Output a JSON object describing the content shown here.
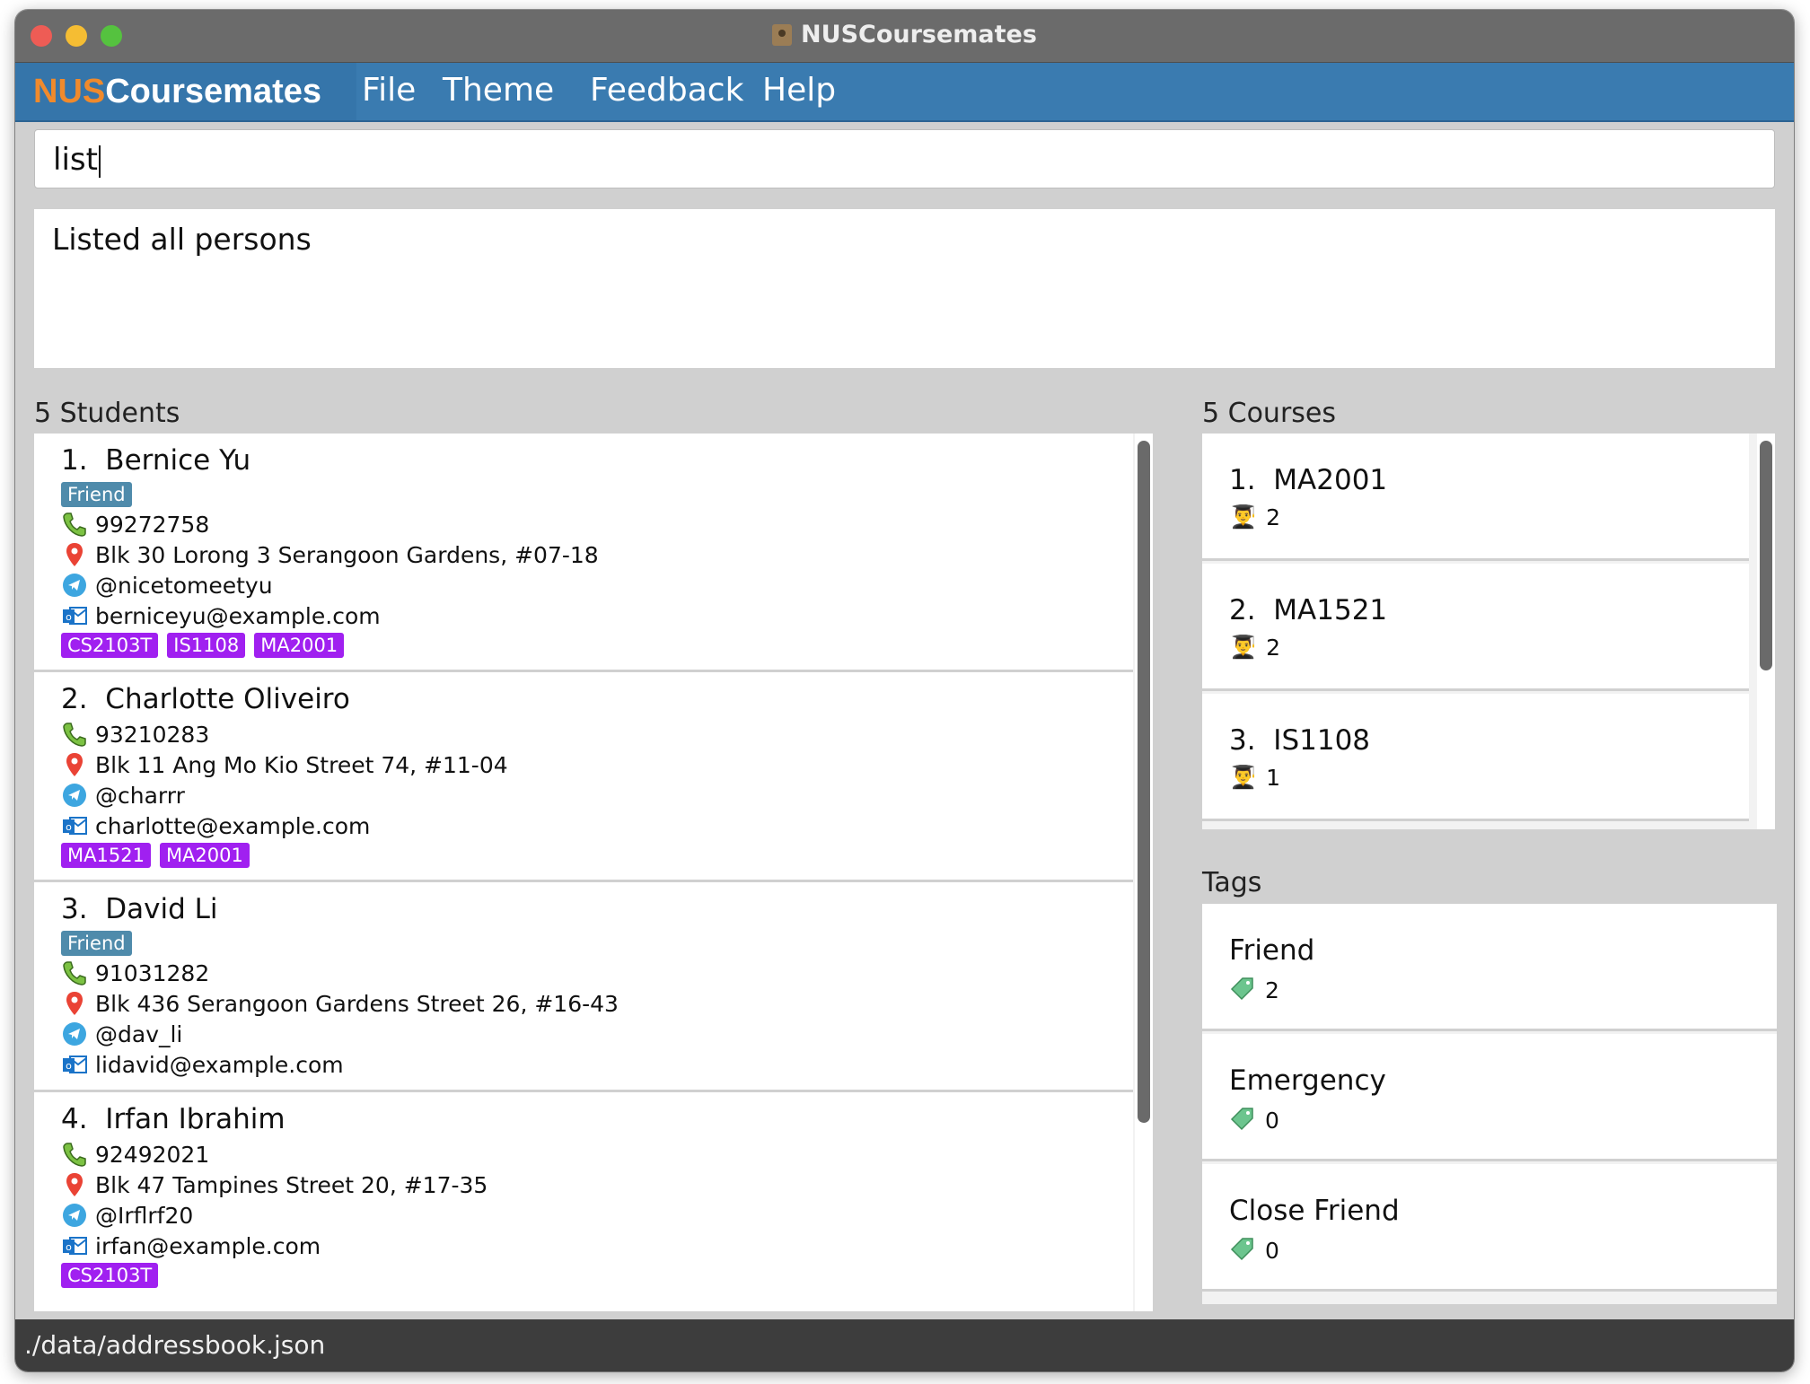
{
  "window": {
    "title": "NUSCoursemates"
  },
  "menubar": {
    "brand_nus": "NUS",
    "brand_rest": "Coursemates",
    "items": [
      "File",
      "Theme",
      "Feedback",
      "Help"
    ]
  },
  "command": {
    "value": "list"
  },
  "result": {
    "text": "Listed all persons"
  },
  "students": {
    "label": "5 Students",
    "items": [
      {
        "index": "1.",
        "name": "Bernice Yu",
        "tags": [
          "Friend"
        ],
        "phone": "99272758",
        "address": "Blk 30 Lorong 3 Serangoon Gardens, #07-18",
        "telegram": "@nicetomeetyu",
        "email": "berniceyu@example.com",
        "courses": [
          "CS2103T",
          "IS1108",
          "MA2001"
        ]
      },
      {
        "index": "2.",
        "name": "Charlotte Oliveiro",
        "tags": [],
        "phone": "93210283",
        "address": "Blk 11 Ang Mo Kio Street 74, #11-04",
        "telegram": "@charrr",
        "email": "charlotte@example.com",
        "courses": [
          "MA1521",
          "MA2001"
        ]
      },
      {
        "index": "3.",
        "name": "David Li",
        "tags": [
          "Friend"
        ],
        "phone": "91031282",
        "address": "Blk 436 Serangoon Gardens Street 26, #16-43",
        "telegram": "@dav_li",
        "email": "lidavid@example.com",
        "courses": []
      },
      {
        "index": "4.",
        "name": "Irfan Ibrahim",
        "tags": [],
        "phone": "92492021",
        "address": "Blk 47 Tampines Street 20, #17-35",
        "telegram": "@Irflrf20",
        "email": "irfan@example.com",
        "courses": [
          "CS2103T"
        ]
      }
    ]
  },
  "courses": {
    "label": "5 Courses",
    "items": [
      {
        "index": "1.",
        "code": "MA2001",
        "count": "2"
      },
      {
        "index": "2.",
        "code": "MA1521",
        "count": "2"
      },
      {
        "index": "3.",
        "code": "IS1108",
        "count": "1"
      }
    ]
  },
  "tags": {
    "label": "Tags",
    "items": [
      {
        "name": "Friend",
        "count": "2"
      },
      {
        "name": "Emergency",
        "count": "0"
      },
      {
        "name": "Close Friend",
        "count": "0"
      }
    ]
  },
  "status": {
    "path": "./data/addressbook.json"
  },
  "colors": {
    "menubar": "#3a7bb0",
    "brand_orange": "#f08a2c",
    "friend_tag": "#4f8bab",
    "course_tag": "#a020f0"
  },
  "icons": {
    "phone": "phone-icon",
    "address": "location-pin-icon",
    "telegram": "telegram-icon",
    "email": "outlook-email-icon",
    "student": "student-icon",
    "tag": "tag-icon"
  }
}
